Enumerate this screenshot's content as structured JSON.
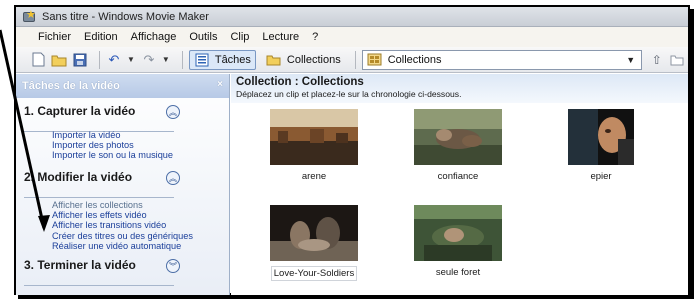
{
  "window": {
    "title": "Sans titre - Windows Movie Maker"
  },
  "menu": [
    "Fichier",
    "Edition",
    "Affichage",
    "Outils",
    "Clip",
    "Lecture",
    "?"
  ],
  "toolbar": {
    "tasks_label": "Tâches",
    "collections_label": "Collections",
    "collection_select_value": "Collections"
  },
  "taskpane": {
    "header": "Tâches de la vidéo",
    "close": "×",
    "sections": [
      {
        "title": "1. Capturer la vidéo",
        "links": [
          "Importer la vidéo",
          "Importer des photos",
          "Importer le son ou la musique"
        ]
      },
      {
        "title": "2. Modifier la vidéo",
        "links": [
          "Afficher les collections",
          "Afficher les effets vidéo",
          "Afficher les transitions vidéo",
          "Créer des titres ou des génériques",
          "Réaliser une vidéo automatique"
        ]
      },
      {
        "title": "3. Terminer la vidéo",
        "links": []
      }
    ]
  },
  "content": {
    "title": "Collection : Collections",
    "subtitle": "Déplacez un clip et placez-le sur la chronologie ci-dessous.",
    "clips": [
      {
        "label": "arene"
      },
      {
        "label": "confiance"
      },
      {
        "label": "epier"
      },
      {
        "label": "Love-Your-Soldiers"
      },
      {
        "label": "seule foret"
      }
    ]
  }
}
